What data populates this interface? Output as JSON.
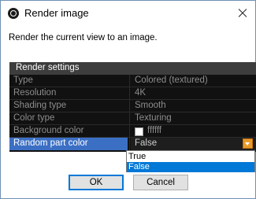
{
  "window": {
    "title": "Render image"
  },
  "description": "Render the current view to an image.",
  "grid": {
    "header": "Render settings",
    "rows": [
      {
        "label": "Type",
        "value": "Colored (textured)"
      },
      {
        "label": "Resolution",
        "value": "4K"
      },
      {
        "label": "Shading type",
        "value": "Smooth"
      },
      {
        "label": "Color type",
        "value": "Texturing"
      },
      {
        "label": "Background color",
        "value": "ffffff",
        "swatch_color": "#ffffff"
      },
      {
        "label": "Random part color",
        "value": "False"
      }
    ]
  },
  "dropdown": {
    "options": [
      "True",
      "False"
    ],
    "selected": "False"
  },
  "buttons": {
    "ok": "OK",
    "cancel": "Cancel"
  },
  "colors": {
    "selection_blue": "#3b6fc4",
    "dropdown_highlight": "#0078d7",
    "dropdown_button": "#e89a2a",
    "grid_background": "#111111",
    "grid_header": "#3d3d3d"
  }
}
